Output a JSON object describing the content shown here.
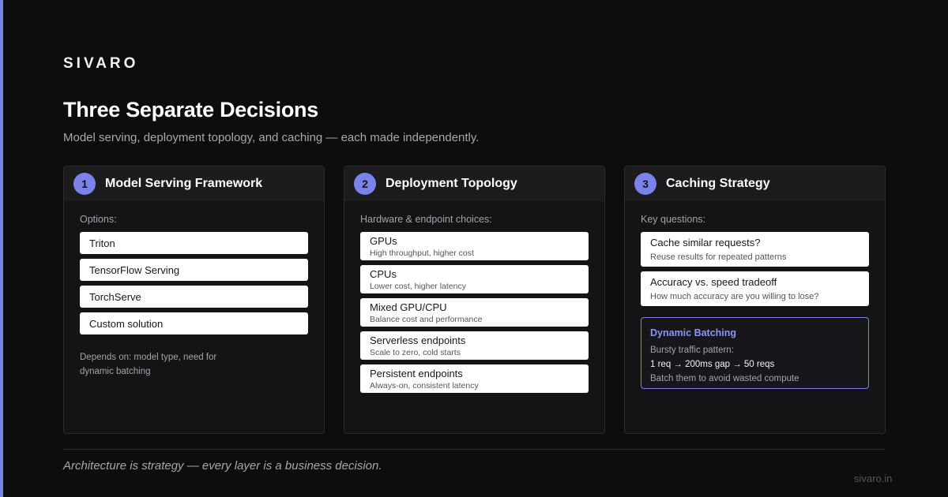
{
  "brand": "SIVARO",
  "title": "Three Separate Decisions",
  "subtitle": "Model serving, deployment topology, and caching — each made independently.",
  "colors": {
    "accent": "#7b83eb",
    "background": "#0d0d0e",
    "card": "#141416"
  },
  "cards": [
    {
      "number": "1",
      "title": "Model Serving Framework",
      "lead": "Options:",
      "options": [
        "Triton",
        "TensorFlow Serving",
        "TorchServe",
        "Custom solution"
      ],
      "note": "Depends on: model type, need for dynamic batching"
    },
    {
      "number": "2",
      "title": "Deployment Topology",
      "lead": "Hardware & endpoint choices:",
      "items": [
        {
          "name": "GPUs",
          "desc": "High throughput, higher cost"
        },
        {
          "name": "CPUs",
          "desc": "Lower cost, higher latency"
        },
        {
          "name": "Mixed GPU/CPU",
          "desc": "Balance cost and performance"
        },
        {
          "name": "Serverless endpoints",
          "desc": "Scale to zero, cold starts"
        },
        {
          "name": "Persistent endpoints",
          "desc": "Always-on, consistent latency"
        }
      ]
    },
    {
      "number": "3",
      "title": "Caching Strategy",
      "lead": "Key questions:",
      "questions": [
        {
          "title": "Cache similar requests?",
          "desc": "Reuse results for repeated patterns"
        },
        {
          "title": "Accuracy vs. speed tradeoff",
          "desc": "How much accuracy are you willing to lose?"
        }
      ],
      "highlight": {
        "title": "Dynamic Batching",
        "line1": "Bursty traffic pattern:",
        "line2": "1 req → 200ms gap → 50 reqs",
        "line3": "Batch them to avoid wasted compute"
      }
    }
  ],
  "footer": "Architecture is strategy — every layer is a business decision.",
  "url": "sivaro.in"
}
